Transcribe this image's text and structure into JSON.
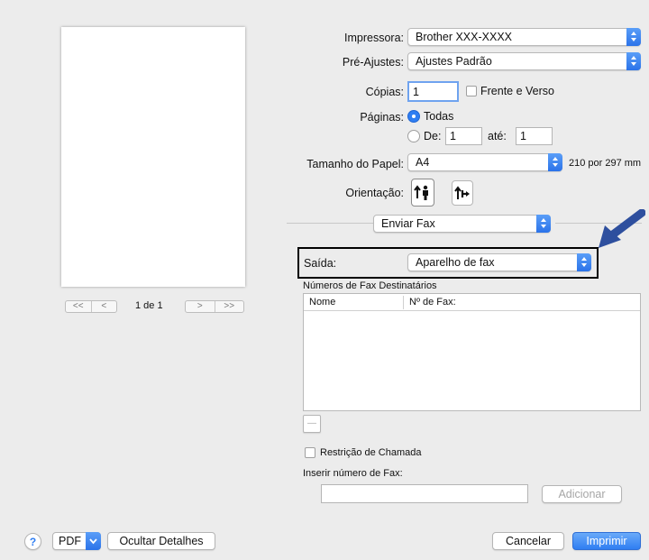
{
  "preview": {
    "page_indicator": "1 de 1",
    "nav_first": "<<",
    "nav_prev": "<",
    "nav_next": ">",
    "nav_last": ">>"
  },
  "printer": {
    "label": "Impressora:",
    "value": "Brother XXX-XXXX"
  },
  "presets": {
    "label": "Pré-Ajustes:",
    "value": "Ajustes Padrão"
  },
  "copies": {
    "label": "Cópias:",
    "value": "1",
    "duplex_label": "Frente e Verso",
    "duplex_checked": false
  },
  "pages": {
    "label": "Páginas:",
    "all_label": "Todas",
    "from_label": "De:",
    "from_value": "1",
    "to_label": "até:",
    "to_value": "1",
    "selected": "all"
  },
  "paper": {
    "label": "Tamanho do Papel:",
    "value": "A4",
    "dimensions": "210 por 297 mm"
  },
  "orientation": {
    "label": "Orientação:",
    "selected": "portrait"
  },
  "section": {
    "value": "Enviar Fax"
  },
  "output": {
    "label": "Saída:",
    "value": "Aparelho de fax"
  },
  "recipients": {
    "title": "Números de Fax Destinatários",
    "col_name": "Nome",
    "col_fax": "Nº de Fax:",
    "rows": [],
    "remove_label": "—"
  },
  "call_restriction": {
    "label": "Restrição de Chamada",
    "checked": false
  },
  "fax_entry": {
    "label": "Inserir número de Fax:",
    "value": "",
    "add_label": "Adicionar"
  },
  "footer": {
    "help": "?",
    "pdf_label": "PDF",
    "hide_details": "Ocultar Detalhes",
    "cancel": "Cancelar",
    "print": "Imprimir"
  },
  "colors": {
    "accent": "#2f7ef2",
    "highlight_arrow": "#2e4f9e",
    "highlight_box": "#000000"
  }
}
